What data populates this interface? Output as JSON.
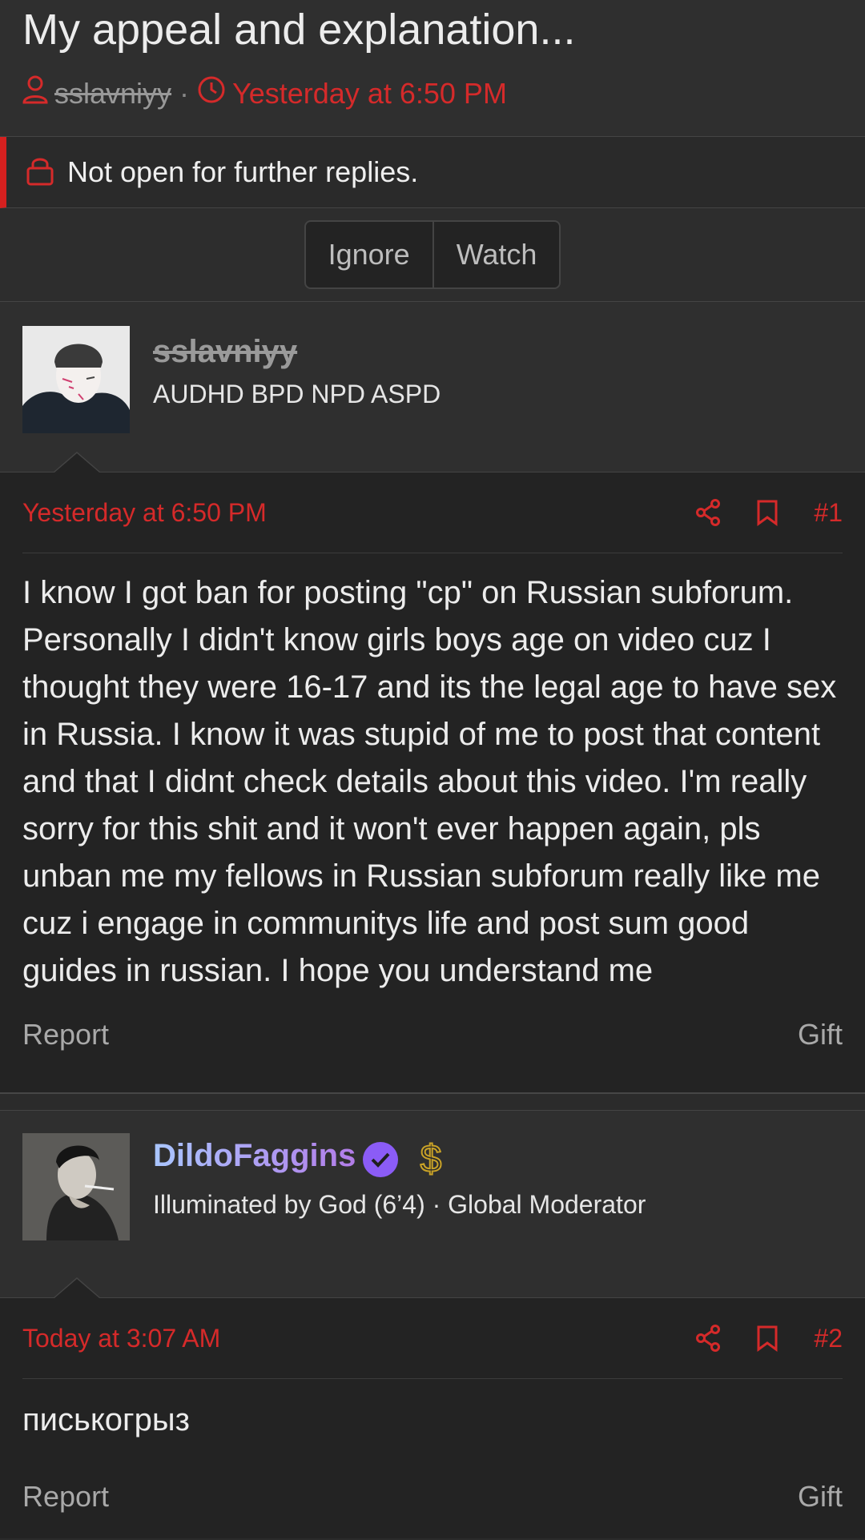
{
  "thread": {
    "title": "My appeal and explanation...",
    "author": "sslavniyy",
    "separator": "·",
    "date": "Yesterday at 6:50 PM"
  },
  "notice": {
    "text": "Not open for further replies."
  },
  "actions": {
    "ignore": "Ignore",
    "watch": "Watch"
  },
  "posts": [
    {
      "username": "sslavniyy",
      "user_title": "AUDHD BPD NPD ASPD",
      "date": "Yesterday at 6:50 PM",
      "number": "#1",
      "body": "I know I got ban for posting \"cp\" on Russian subforum. Personally I didn't know girls boys age on video cuz I thought they were 16-17 and its the legal age to have sex in Russia. I know it was stupid of me to post that content and that I didnt check details about this video. I'm really sorry for this shit and it won't ever happen again, pls unban me my fellows in Russian subforum really like me cuz i engage in communitys life and post sum good guides in russian. I hope you understand me",
      "report": "Report",
      "gift": "Gift"
    },
    {
      "username": "DildoFaggins",
      "user_title": "Illuminated by God (6’4) · Global Moderator",
      "date": "Today at 3:07 AM",
      "number": "#2",
      "body": "писькогрыз",
      "report": "Report",
      "gift": "Gift"
    }
  ],
  "colors": {
    "accent": "#d52a2a",
    "background": "#232323",
    "verified": "#8b5cf6",
    "dollar": "#c9a227"
  }
}
